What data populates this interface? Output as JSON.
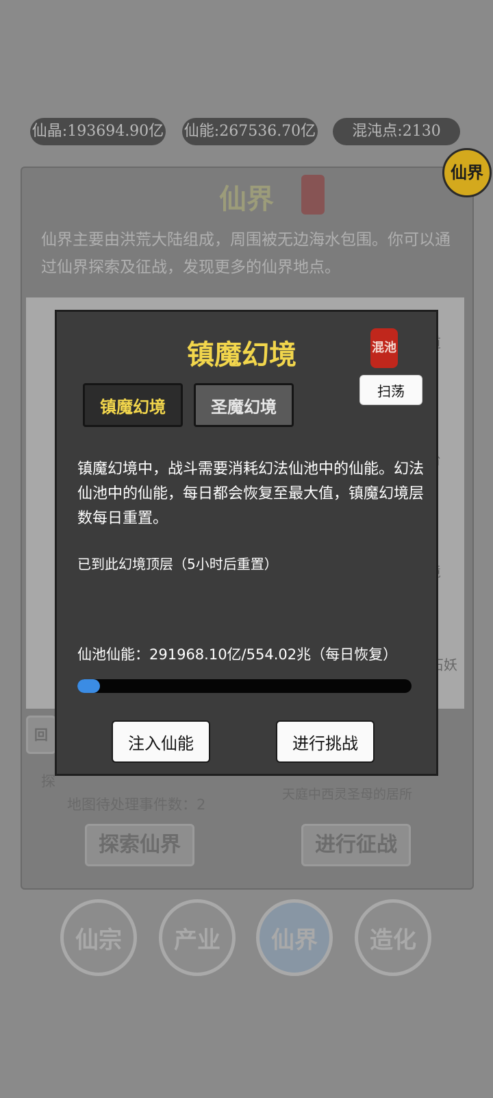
{
  "resources": {
    "crystal": "仙晶:193694.90亿",
    "energy": "仙能:267536.70亿",
    "chaos": "混沌点:2130"
  },
  "corner_badge": "仙界",
  "panel": {
    "title": "仙界",
    "description": "仙界主要由洪荒大陆组成，周围被无边海水包围。你可以通过仙界探索及征战，发现更多的仙界地点。",
    "map_labels": [
      "道",
      "台",
      "境",
      "石妖"
    ],
    "back_button": "回",
    "explore_prefix": "探",
    "pending_events": "地图待处理事件数：2",
    "location_hint": "天庭中西灵圣母的居所",
    "explore_button": "探索仙界",
    "campaign_button": "进行征战"
  },
  "bottom_nav": [
    {
      "label": "仙宗"
    },
    {
      "label": "产业"
    },
    {
      "label": "仙界"
    },
    {
      "label": "造化"
    }
  ],
  "modal": {
    "title": "镇魔幻境",
    "seal": "混池",
    "tabs": [
      {
        "label": "镇魔幻境",
        "active": true
      },
      {
        "label": "圣魔幻境",
        "active": false
      }
    ],
    "sweep_button": "扫荡",
    "description": "镇魔幻境中，战斗需要消耗幻法仙池中的仙能。幻法仙池中的仙能，每日都会恢复至最大值，镇魔幻境层数每日重置。",
    "status": "已到此幻境顶层（5小时后重置）",
    "pool_label": "仙池仙能：291968.10亿/554.02兆（每日恢复）",
    "pool_progress": 0.067,
    "inject_button": "注入仙能",
    "challenge_button": "进行挑战"
  }
}
